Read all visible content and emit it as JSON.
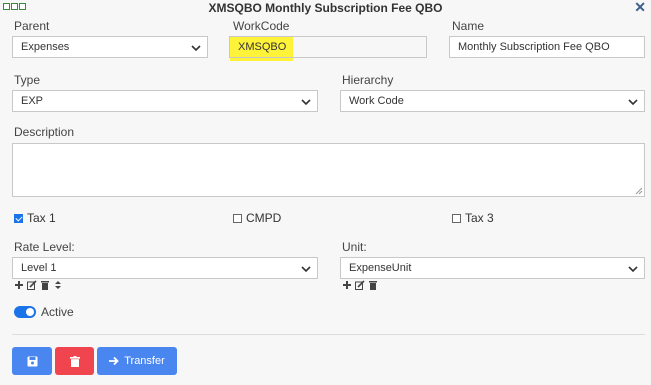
{
  "window": {
    "title": "XMSQBO Monthly Subscription Fee QBO"
  },
  "fields": {
    "parent": {
      "label": "Parent",
      "value": "Expenses"
    },
    "workcode": {
      "label": "WorkCode",
      "value": "XMSQBO"
    },
    "name": {
      "label": "Name",
      "value": "Monthly Subscription Fee QBO"
    },
    "type": {
      "label": "Type",
      "value": "EXP"
    },
    "hierarchy": {
      "label": "Hierarchy",
      "value": "Work Code"
    },
    "description": {
      "label": "Description",
      "value": ""
    },
    "rate_level": {
      "label": "Rate Level:",
      "value": "Level 1"
    },
    "unit": {
      "label": "Unit:",
      "value": "ExpenseUnit"
    }
  },
  "checkboxes": {
    "tax1": {
      "label": "Tax 1",
      "checked": true
    },
    "cmpd": {
      "label": "CMPD",
      "checked": false
    },
    "tax3": {
      "label": "Tax 3",
      "checked": false
    }
  },
  "active": {
    "label": "Active",
    "on": true
  },
  "buttons": {
    "transfer_label": "Transfer"
  },
  "colors": {
    "primary": "#4a86f0",
    "danger": "#f0444f",
    "highlight": "#fff33a",
    "toggle": "#1a73e8"
  }
}
